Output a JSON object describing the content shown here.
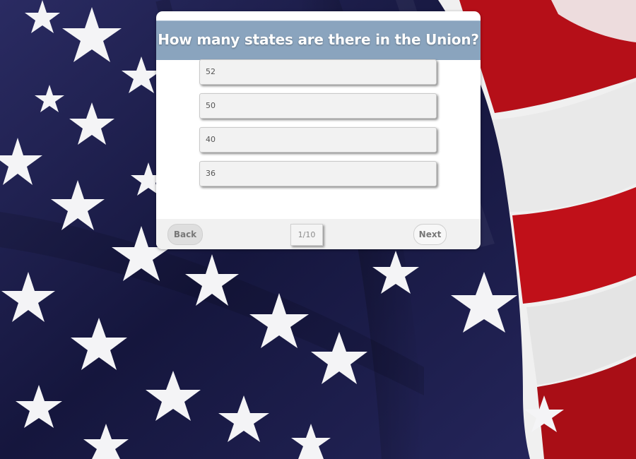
{
  "quiz": {
    "question": "How many states are there in the Union?",
    "options": [
      {
        "label": "52"
      },
      {
        "label": "50"
      },
      {
        "label": "40"
      },
      {
        "label": "36"
      }
    ]
  },
  "navigation": {
    "back_label": "Back",
    "next_label": "Next",
    "page_indicator": "1/10"
  },
  "theme": {
    "header_color": "#8aa4be",
    "flag_blue": "#1c1d4a",
    "flag_red": "#b0101a",
    "flag_white": "#f2f2f2"
  }
}
